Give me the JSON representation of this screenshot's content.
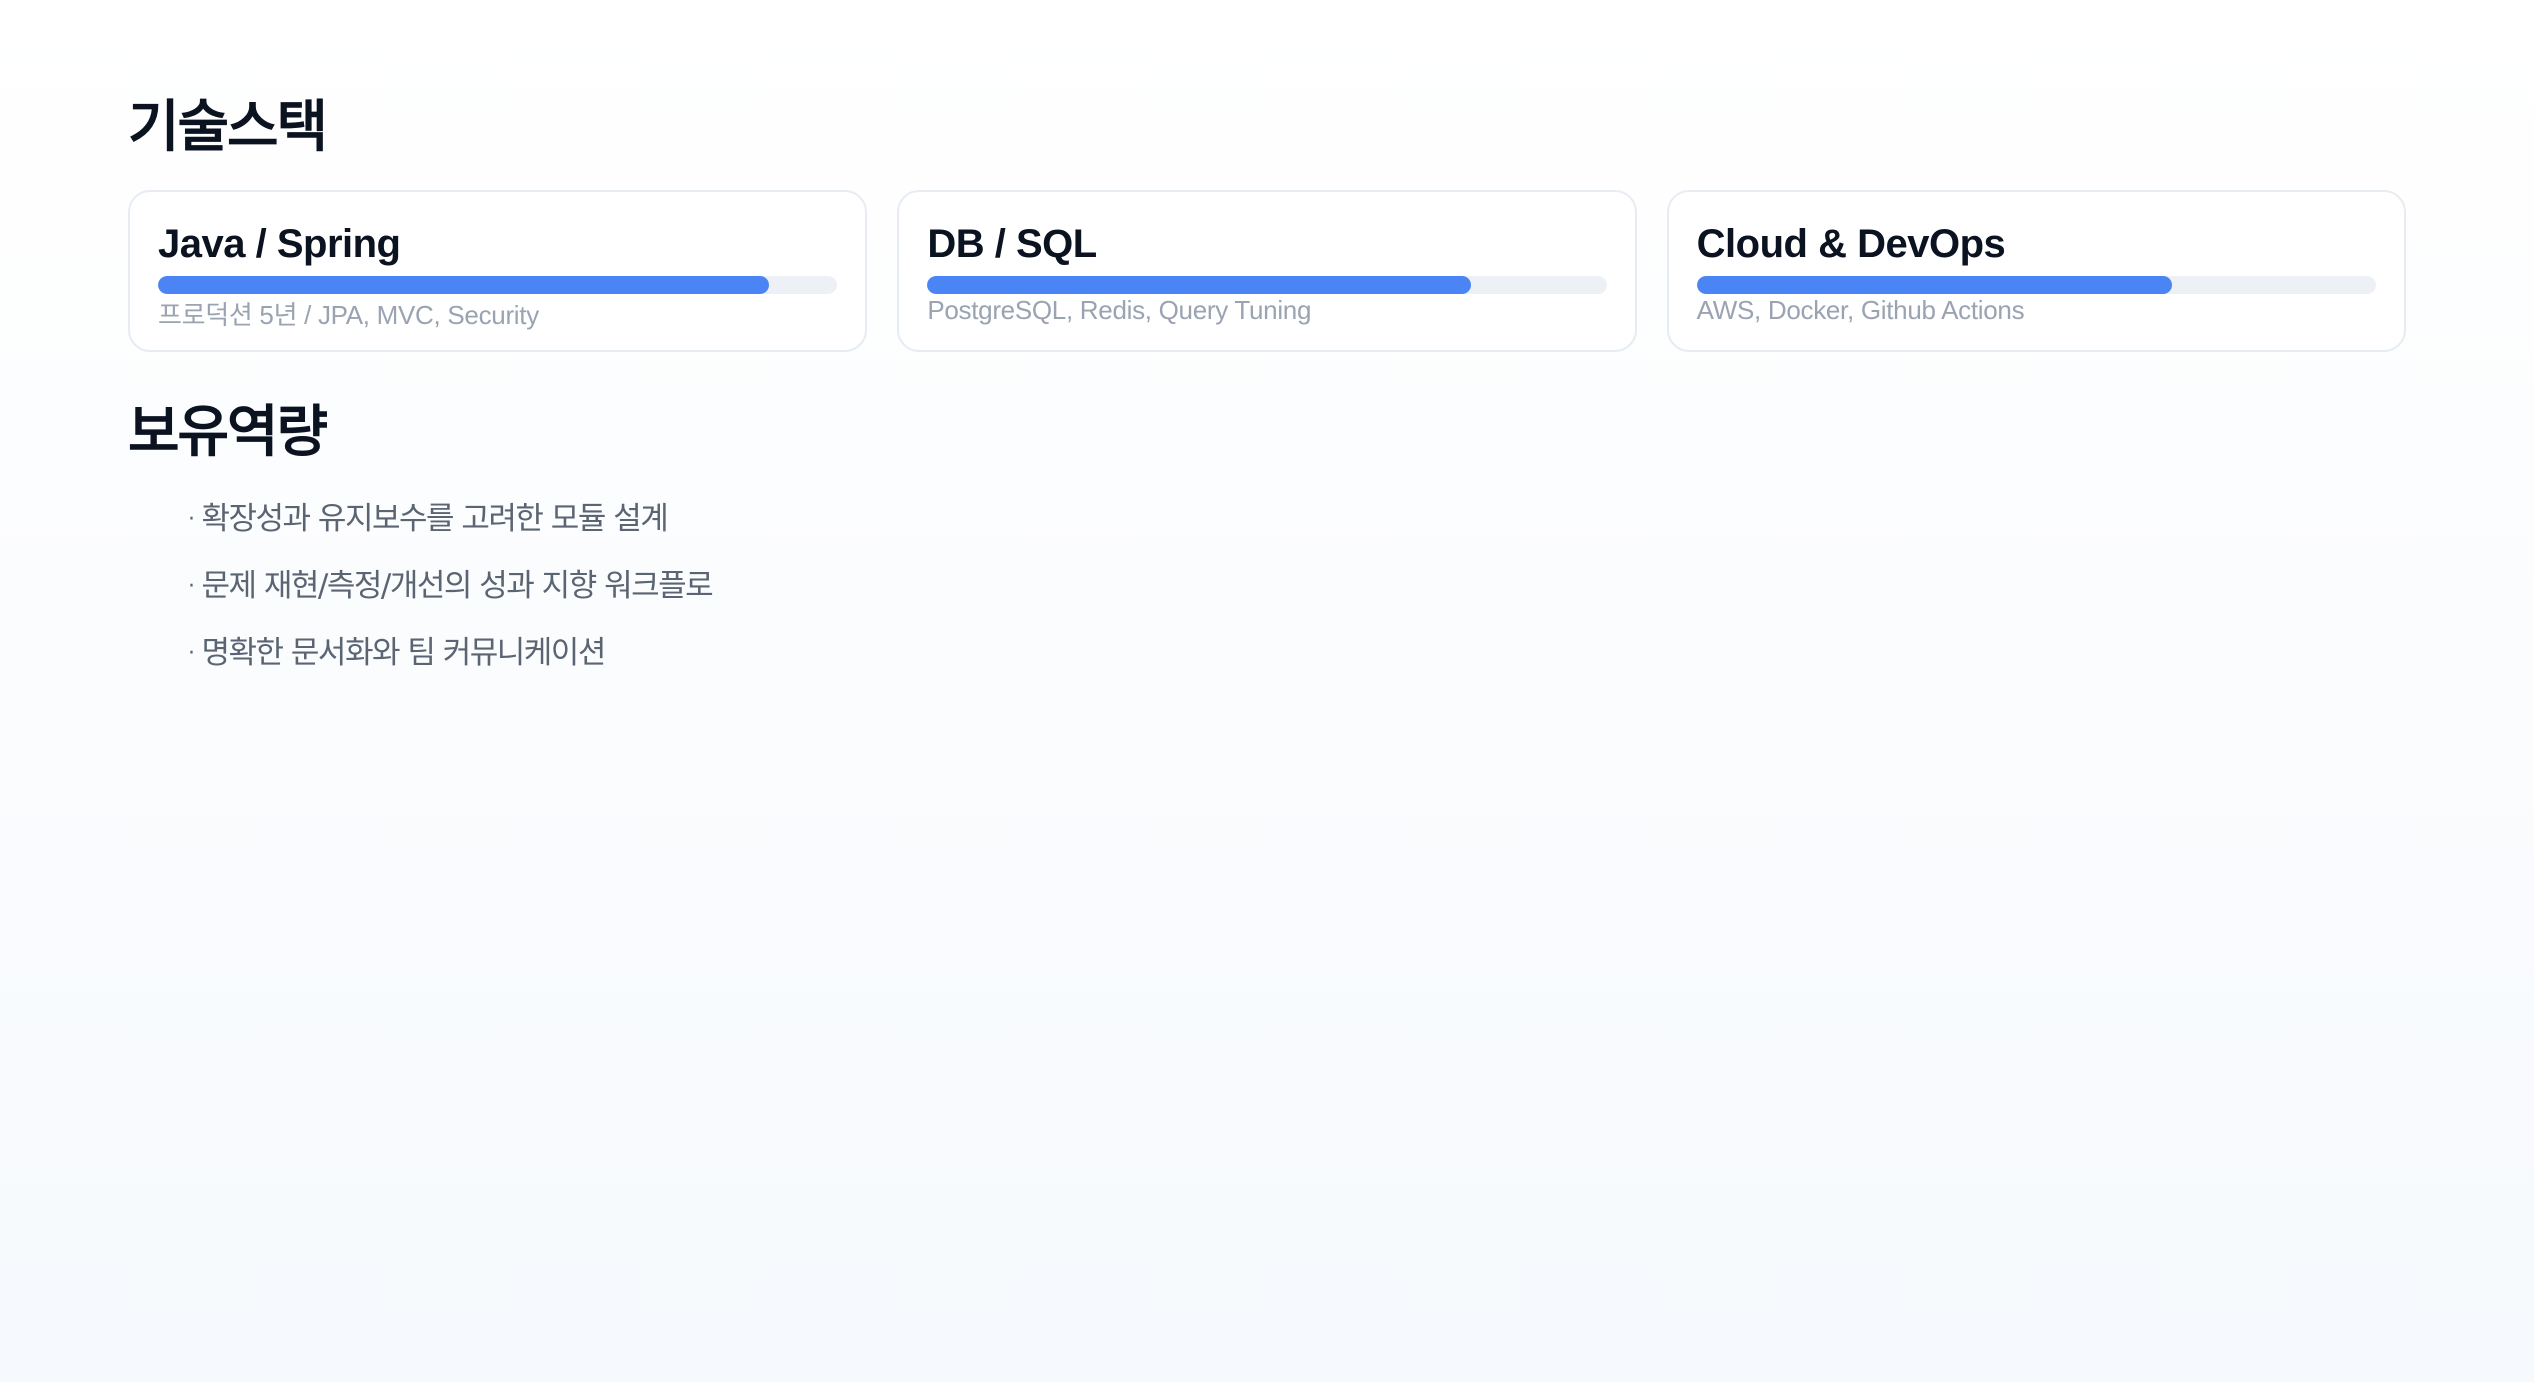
{
  "skills": {
    "title": "기술스택",
    "cards": [
      {
        "name": "Java / Spring",
        "level": 0.9,
        "desc": "프로덕션 5년 / JPA, MVC, Security"
      },
      {
        "name": "DB / SQL",
        "level": 0.8,
        "desc": "PostgreSQL, Redis, Query Tuning"
      },
      {
        "name": "Cloud & DevOps",
        "level": 0.7,
        "desc": "AWS, Docker, Github Actions"
      }
    ]
  },
  "strengths": {
    "title": "보유역량",
    "bullet": "·",
    "items": [
      "확장성과 유지보수를 고려한 모듈 설계",
      "문제 재현/측정/개선의 성과 지향 워크플로",
      "명확한 문서화와 팀 커뮤니케이션"
    ]
  },
  "colors": {
    "accent": "#4b85f5",
    "track": "#edf1f6",
    "title": "#0b1220",
    "muted": "#9aa3b1"
  }
}
